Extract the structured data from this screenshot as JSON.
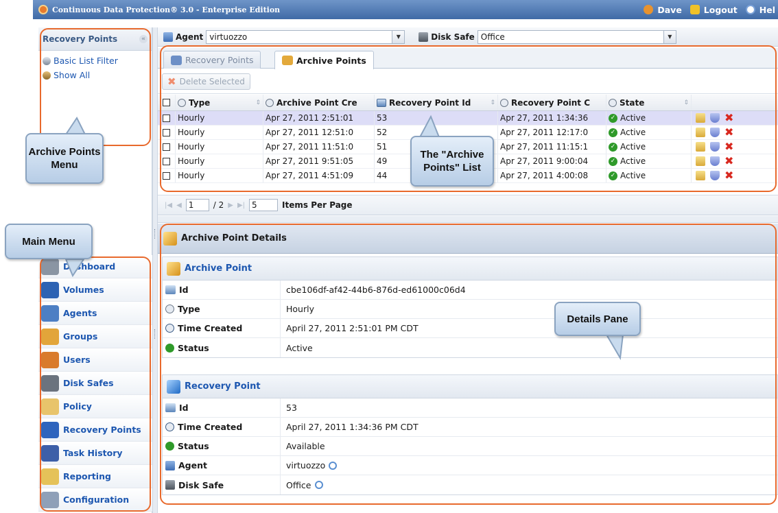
{
  "titlebar": {
    "title": "Continuous Data Protection® 3.0 - Enterprise Edition",
    "user": "Dave",
    "logout": "Logout",
    "help": "Hel"
  },
  "left_panel": {
    "header": "Recovery Points",
    "collapse_glyph": "«",
    "filters": [
      {
        "label": "Basic List Filter",
        "icon": "filter-icon"
      },
      {
        "label": "Show All",
        "icon": "show-all-icon"
      }
    ]
  },
  "main_menu": [
    {
      "label": "Dashboard",
      "icon": "dashboard-icon",
      "color": "#8a95a3"
    },
    {
      "label": "Volumes",
      "icon": "volumes-icon",
      "color": "#2d63b3"
    },
    {
      "label": "Agents",
      "icon": "agents-icon",
      "color": "#4d7fc4"
    },
    {
      "label": "Groups",
      "icon": "groups-icon",
      "color": "#e2a53a"
    },
    {
      "label": "Users",
      "icon": "users-icon",
      "color": "#d97b2c"
    },
    {
      "label": "Disk Safes",
      "icon": "disk-safes-icon",
      "color": "#6b737e"
    },
    {
      "label": "Policy",
      "icon": "policy-icon",
      "color": "#e8c46b"
    },
    {
      "label": "Recovery Points",
      "icon": "recovery-points-icon",
      "color": "#2e64bd"
    },
    {
      "label": "Task History",
      "icon": "task-history-icon",
      "color": "#3d5fa8"
    },
    {
      "label": "Reporting",
      "icon": "reporting-icon",
      "color": "#e5c259"
    },
    {
      "label": "Configuration",
      "icon": "configuration-icon",
      "color": "#8fa0b8"
    }
  ],
  "agent_bar": {
    "agent_label": "Agent",
    "agent_value": "virtuozzo",
    "disk_safe_label": "Disk Safe",
    "disk_safe_value": "Office"
  },
  "tabs": [
    {
      "label": "Recovery Points",
      "active": false
    },
    {
      "label": "Archive Points",
      "active": true
    }
  ],
  "toolbar": {
    "delete_selected": "Delete Selected"
  },
  "grid": {
    "columns": [
      "Type",
      "Archive Point Cre",
      "Recovery Point Id",
      "Recovery Point C",
      "State"
    ],
    "rows": [
      {
        "type": "Hourly",
        "created": "Apr 27, 2011 2:51:01",
        "rp_id": "53",
        "rp_created": "Apr 27, 2011 1:34:36",
        "state": "Active",
        "selected": true
      },
      {
        "type": "Hourly",
        "created": "Apr 27, 2011 12:51:0",
        "rp_id": "52",
        "rp_created": "Apr 27, 2011 12:17:0",
        "state": "Active",
        "selected": false
      },
      {
        "type": "Hourly",
        "created": "Apr 27, 2011 11:51:0",
        "rp_id": "51",
        "rp_created": "Apr 27, 2011 11:15:1",
        "state": "Active",
        "selected": false
      },
      {
        "type": "Hourly",
        "created": "Apr 27, 2011 9:51:05",
        "rp_id": "49",
        "rp_created": "Apr 27, 2011 9:00:04",
        "state": "Active",
        "selected": false
      },
      {
        "type": "Hourly",
        "created": "Apr 27, 2011 4:51:09",
        "rp_id": "44",
        "rp_created": "Apr 27, 2011 4:00:08",
        "state": "Active",
        "selected": false
      }
    ]
  },
  "pager": {
    "page": "1",
    "total": "/ 2",
    "per_page": "5",
    "per_page_label": "Items Per Page"
  },
  "details": {
    "header": "Archive Point Details",
    "archive_point": {
      "title": "Archive Point",
      "rows": [
        {
          "key": "Id",
          "value": "cbe106df-af42-44b6-876d-ed61000c06d4",
          "icon": "id-icon"
        },
        {
          "key": "Type",
          "value": "Hourly",
          "icon": "type-icon"
        },
        {
          "key": "Time Created",
          "value": "April 27, 2011 2:51:01 PM CDT",
          "icon": "clock-icon"
        },
        {
          "key": "Status",
          "value": "Active",
          "icon": "status-icon"
        }
      ]
    },
    "recovery_point": {
      "title": "Recovery Point",
      "rows": [
        {
          "key": "Id",
          "value": "53",
          "icon": "id-icon"
        },
        {
          "key": "Time Created",
          "value": "April 27, 2011 1:34:36 PM CDT",
          "icon": "clock-icon"
        },
        {
          "key": "Status",
          "value": "Available",
          "icon": "status-icon"
        },
        {
          "key": "Agent",
          "value": "virtuozzo",
          "icon": "agent-icon"
        },
        {
          "key": "Disk Safe",
          "value": "Office",
          "icon": "disk-safe-icon"
        }
      ]
    }
  },
  "callouts": {
    "archive_menu": "Archive Points Menu",
    "main_menu": "Main Menu",
    "list": "The \"Archive Points\" List",
    "details": "Details Pane"
  },
  "colors": {
    "titlebar": "#3f6aa6",
    "highlight_outline": "#e8692c",
    "selected_row": "#ddddf7",
    "link": "#1d57b0"
  }
}
